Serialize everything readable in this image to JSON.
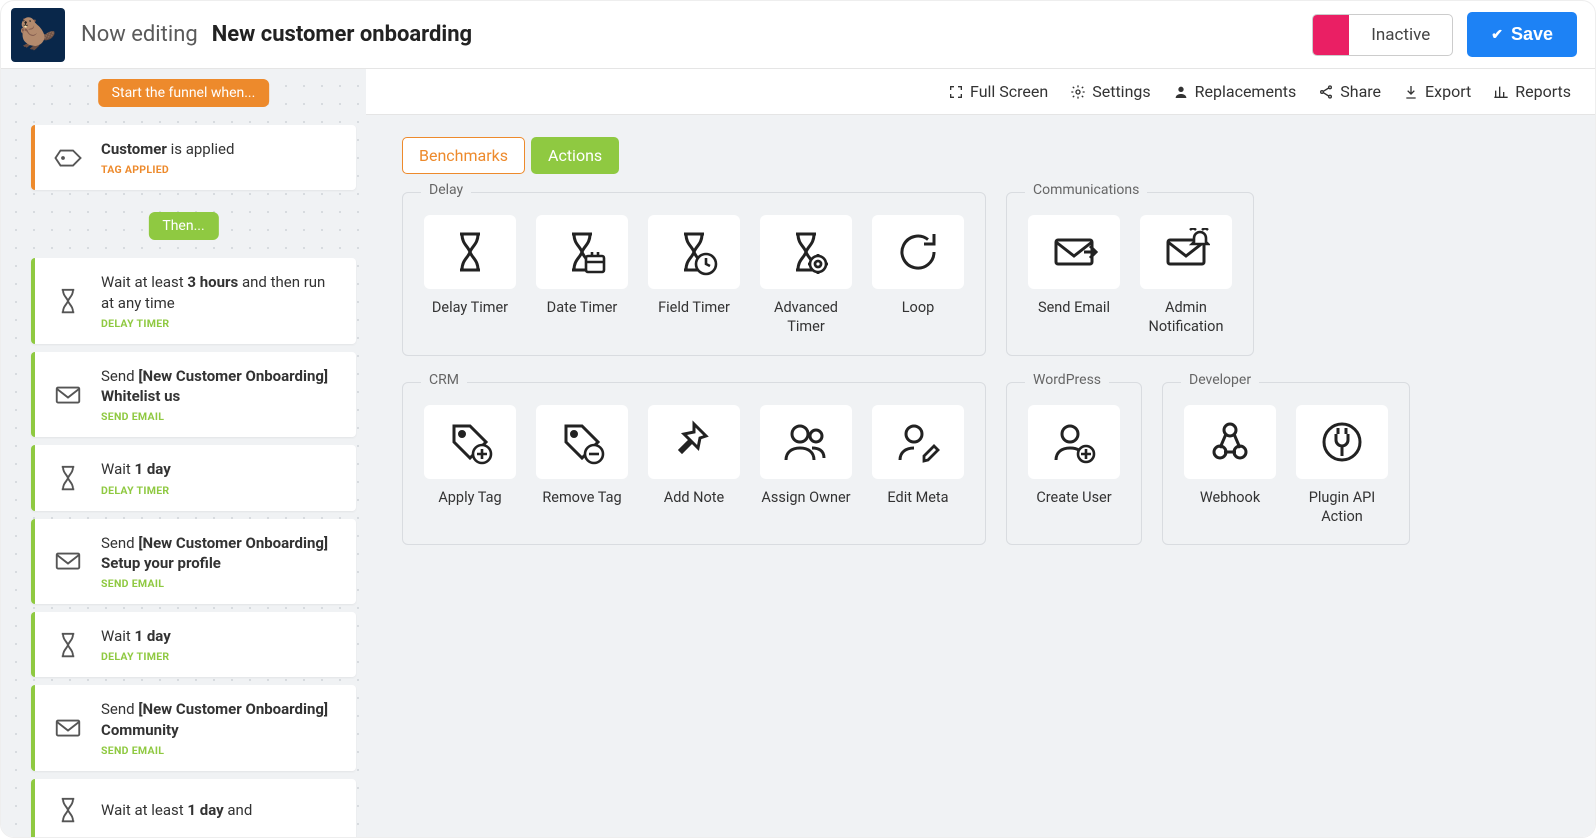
{
  "header": {
    "editing_label": "Now editing",
    "funnel_name": "New customer onboarding",
    "status_text": "Inactive",
    "status_color": "#ea1f64",
    "save_label": "Save"
  },
  "toolbar": {
    "full_screen": "Full Screen",
    "settings": "Settings",
    "replacements": "Replacements",
    "share": "Share",
    "export": "Export",
    "reports": "Reports"
  },
  "sidebar": {
    "start_chip": "Start the funnel when...",
    "then_chip": "Then...",
    "steps": [
      {
        "type": "orange",
        "icon": "tag",
        "title_html": "<b>Customer</b> is applied",
        "sub": "TAG APPLIED"
      },
      {
        "type": "green",
        "icon": "hourglass",
        "title_html": "Wait at least <b>3 hours</b> and then run at any time",
        "sub": "DELAY TIMER"
      },
      {
        "type": "green",
        "icon": "mail",
        "title_html": "Send <b>[New Customer Onboarding] Whitelist us</b>",
        "sub": "SEND EMAIL"
      },
      {
        "type": "green",
        "icon": "hourglass",
        "title_html": "Wait <b>1 day</b>",
        "sub": "DELAY TIMER"
      },
      {
        "type": "green",
        "icon": "mail",
        "title_html": "Send <b>[New Customer Onboarding] Setup your profile</b>",
        "sub": "SEND EMAIL"
      },
      {
        "type": "green",
        "icon": "hourglass",
        "title_html": "Wait <b>1 day</b>",
        "sub": "DELAY TIMER"
      },
      {
        "type": "green",
        "icon": "mail",
        "title_html": "Send <b>[New Customer Onboarding] Community</b>",
        "sub": "SEND EMAIL"
      },
      {
        "type": "green",
        "icon": "hourglass",
        "title_html": "Wait at least <b>1 day</b> and",
        "sub": ""
      }
    ]
  },
  "tabs": {
    "benchmarks": "Benchmarks",
    "actions": "Actions"
  },
  "groups": [
    {
      "label": "Delay",
      "row": 0,
      "tiles": [
        {
          "name": "delay-timer",
          "label": "Delay Timer",
          "icon": "hourglass"
        },
        {
          "name": "date-timer",
          "label": "Date Timer",
          "icon": "hourglass-cal"
        },
        {
          "name": "field-timer",
          "label": "Field Timer",
          "icon": "hourglass-clock"
        },
        {
          "name": "advanced-timer",
          "label": "Advanced Timer",
          "icon": "hourglass-gear"
        },
        {
          "name": "loop",
          "label": "Loop",
          "icon": "loop"
        }
      ]
    },
    {
      "label": "Communications",
      "row": 0,
      "tiles": [
        {
          "name": "send-email",
          "label": "Send Email",
          "icon": "mail-arrow"
        },
        {
          "name": "admin-notification",
          "label": "Admin Notification",
          "icon": "mail-bell"
        }
      ]
    },
    {
      "label": "CRM",
      "row": 1,
      "tiles": [
        {
          "name": "apply-tag",
          "label": "Apply Tag",
          "icon": "tag-plus"
        },
        {
          "name": "remove-tag",
          "label": "Remove Tag",
          "icon": "tag-minus"
        },
        {
          "name": "add-note",
          "label": "Add Note",
          "icon": "pin"
        },
        {
          "name": "assign-owner",
          "label": "Assign Owner",
          "icon": "users"
        },
        {
          "name": "edit-meta",
          "label": "Edit Meta",
          "icon": "user-edit"
        }
      ]
    },
    {
      "label": "WordPress",
      "row": 1,
      "tiles": [
        {
          "name": "create-user",
          "label": "Create User",
          "icon": "user-plus"
        }
      ]
    },
    {
      "label": "Developer",
      "row": 1,
      "tiles": [
        {
          "name": "webhook",
          "label": "Webhook",
          "icon": "webhook"
        },
        {
          "name": "plugin-api-action",
          "label": "Plugin API Action",
          "icon": "plug"
        }
      ]
    }
  ]
}
